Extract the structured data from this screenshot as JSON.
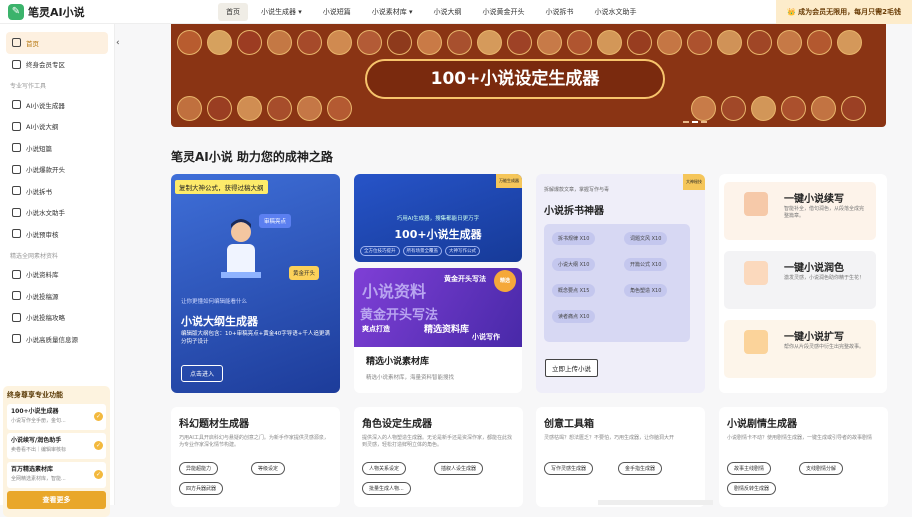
{
  "app": {
    "logo_text": "笔灵AI小说",
    "vip_text": "成为会员无限用，每月只需2毛钱"
  },
  "nav": {
    "items": [
      "首页",
      "小说生成器",
      "小说短篇",
      "小说素材库",
      "小说大纲",
      "小说黄金开头",
      "小说拆书",
      "小说水文助手"
    ]
  },
  "sidebar": {
    "home": "首页",
    "member": "终身会员专区",
    "section1": "专业写作工具",
    "tools": [
      "AI小说生成器",
      "AI小说大纲",
      "小说短篇",
      "小说爆款开头",
      "小说拆书",
      "小说水文助手",
      "小说预审核"
    ],
    "section2": "精选全网素材资料",
    "materials": [
      "小说资料库",
      "小说投稿源",
      "小说投稿攻略",
      "小说高质量信息源"
    ]
  },
  "promo": {
    "title": "终身尊享专业功能",
    "items": [
      {
        "title": "100+小说生成器",
        "sub": "小说写作全手册，金句..."
      },
      {
        "title": "小说续写/润色助手",
        "sub": "卖卷看不出｜编辑审核标"
      },
      {
        "title": "百万精选素材库",
        "sub": "全网精选素材库，智能..."
      }
    ],
    "button": "查看更多"
  },
  "banner": {
    "title": "100+小说设定生成器"
  },
  "headline": "笔灵AI小说 助力您的成神之路",
  "card_outline": {
    "tag": "复制大神公式，获得过稿大纲",
    "sub": "让你更懂如何编辑能看什么",
    "title": "小说大纲生成器",
    "desc": "编辑版大纲包含：10+审稿亮点+黄金40字导语+千人追更满分钩子设计",
    "button": "点击进入",
    "stamp1": "审稿亮点",
    "stamp2": "黄金开头"
  },
  "card_generator": {
    "sub": "巧用AI生成器，搜集都能日更万字",
    "title": "100+小说生成器",
    "pills": [
      "全方位技巧提升",
      "所有场景全覆盖",
      "大神写作公式"
    ],
    "corner": "万能生成器"
  },
  "card_material": {
    "title": "精选小说素材库",
    "sub": "精选小说素材库，海量资料智能搜找",
    "img_words": [
      "小说资料",
      "黄金开头写法",
      "精选资料库",
      "爽点打造",
      "小说写作"
    ],
    "badge": "精选"
  },
  "card_split": {
    "sub": "拆解爆款文章，掌握写作与毒",
    "title": "小说拆书神器",
    "chips": [
      "拆书规律 X10",
      "词题文风 X10",
      "小说大纲 X10",
      "开篇公式 X10",
      "概念要点 X15",
      "角色塑造 X10",
      "读者痛点 X10"
    ],
    "button": "立即上传小说",
    "corner": "大神秘技"
  },
  "features": [
    {
      "title": "一键小说续写",
      "sub": "智能补全，借句润色，从段落全成完整篇章。"
    },
    {
      "title": "一键小说润色",
      "sub": "激发灵感，小说润色助你精于生花！"
    },
    {
      "title": "一键小说扩写",
      "sub": "帮你从片段灵感中衍生出完整故事。"
    }
  ],
  "bottom_cards": [
    {
      "title": "科幻题材生成器",
      "sub": "巧用AI工具开启科幻与悬疑的创意之门。为新手作家提供灵感源泉，为专业作家深化情节构建。",
      "pills": [
        "异能超能力",
        "等级设定",
        "四方兵器武器"
      ]
    },
    {
      "title": "角色设定生成器",
      "sub": "提供深入的人物塑造生成器。无论是新手还是资深作家，都能在此找到灵感，轻松打造鲜明立体的角色。",
      "pills": [
        "人物关系设定",
        "插叙人设生成器",
        "批量生成人物..."
      ]
    },
    {
      "title": "创意工具箱",
      "sub": "灵感枯竭？想法匮乏？不要怕，巧用生成器，让你脑洞大开",
      "pills": [
        "写作灵感生成器",
        "金手指生成器"
      ]
    },
    {
      "title": "小说剧情生成器",
      "sub": "小说剧情卡不动？使用剧情生成器，一键生成或引导者的故事剧情",
      "pills": [
        "故事主线剧情",
        "支线剧情分解",
        "剧情反转生成器"
      ]
    }
  ]
}
